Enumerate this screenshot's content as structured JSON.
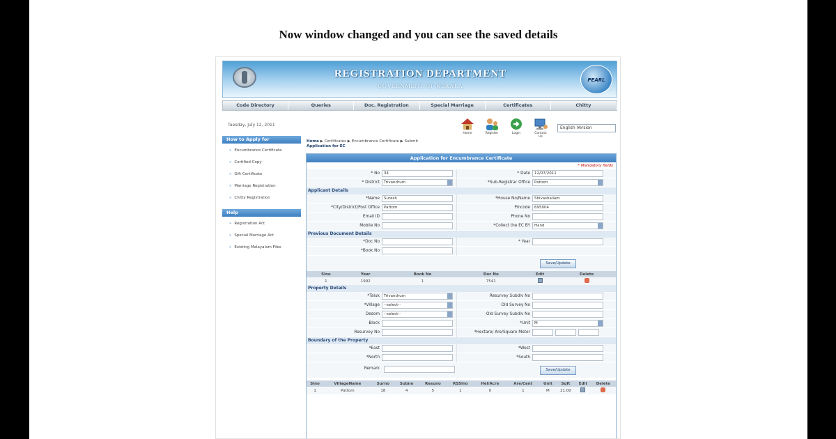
{
  "caption": "Now window changed and you can see the saved details",
  "banner": {
    "title": "REGISTRATION DEPARTMENT",
    "subtitle": "GOVERNMENT OF KERALA",
    "logo_text": "PEARL"
  },
  "nav": [
    "Code Directory",
    "Queries",
    "Doc. Registration",
    "Special Marriage",
    "Certificates",
    "Chitty"
  ],
  "date": "Tuesday, July 12, 2011",
  "toolbar": {
    "icons": [
      "Home",
      "Register",
      "Login",
      "Contact Us"
    ],
    "language": "English Version"
  },
  "sidebar": {
    "how_heading": "How to Apply for",
    "how_items": [
      "Encumbrance Certificate",
      "Certified Copy",
      "Gift Certificate",
      "Marriage Registration",
      "Chitty Registration"
    ],
    "help_heading": "Help",
    "help_items": [
      "Registration Act",
      "Special Marriage Act",
      "Existing Malayalam Files"
    ]
  },
  "breadcrumb": {
    "home": "Home",
    "trail": "Certificates ▶ Encumbrance Certificate ▶ Submit",
    "page": "Application for EC"
  },
  "form": {
    "title": "Application for Encumbrance Certificate",
    "mandatory_note": "* Mandatory fields",
    "top": {
      "no_label": "* No",
      "no_value": "34",
      "date_label": "* Date",
      "date_value": "12/07/2011",
      "district_label": "* District",
      "district_value": "Trivandrum",
      "sro_label": "*Sub-Registrar Office",
      "sro_value": "Pattom"
    },
    "applicant_heading": "Applicant Details",
    "applicant": {
      "name_label": "*Name",
      "name_value": "Suresh",
      "house_label": "*House No/Name",
      "house_value": "Shivashailam",
      "city_label": "*City/District/Post Office",
      "city_value": "Pattom",
      "pincode_label": "Pincode",
      "pincode_value": "695004",
      "email_label": "Email ID",
      "email_value": "",
      "phone_label": "Phone No",
      "phone_value": "",
      "mobile_label": "Mobile No",
      "mobile_value": "",
      "collect_label": "*Collect the EC BY",
      "collect_value": "Hand"
    },
    "prevdoc_heading": "Previous Document Details",
    "prevdoc": {
      "docno_label": "*Doc No",
      "year_label": "* Year",
      "bookno_label": "*Book No",
      "save_button": "Save/Update"
    },
    "doc_table": {
      "headers": [
        "Slno",
        "Year",
        "Book No",
        "Doc No",
        "Edit",
        "Delete"
      ],
      "rows": [
        [
          "1",
          "1992",
          "1",
          "7541"
        ]
      ]
    },
    "property_heading": "Property Details",
    "property": {
      "taluk_label": "*Taluk",
      "taluk_value": "Trivandrum",
      "resurvey_subdiv_label": "Resurvey Subdiv No",
      "village_label": "*Village",
      "village_value": "--select--",
      "oldsurvey_label": "Old Survey No",
      "desom_label": "Desom",
      "desom_value": "--select--",
      "oldsurvey_subdiv_label": "Old Survey Subdiv No",
      "block_label": "Block",
      "unit_label": "*Unit",
      "unit_value": "M",
      "resurveyno_label": "Resurvey No",
      "hectare_label": "*Hectare/ Are/Square Meter"
    },
    "boundary_heading": "Boundary of the Property",
    "boundary": {
      "east_label": "*East",
      "west_label": "*West",
      "north_label": "*North",
      "south_label": "*South",
      "remark_label": "Remark",
      "save_button": "Save/Update"
    },
    "prop_table": {
      "headers": [
        "Slno",
        "VillageName",
        "Surno",
        "Subno",
        "Resuno",
        "RSSlno",
        "Hel/Acre",
        "Are/Cent",
        "Unit",
        "Sqft",
        "Edit",
        "Delete"
      ],
      "rows": [
        [
          "1",
          "Pattom",
          "18",
          "4",
          "5",
          "1",
          "0",
          "1",
          "M",
          "21.00"
        ]
      ]
    }
  }
}
